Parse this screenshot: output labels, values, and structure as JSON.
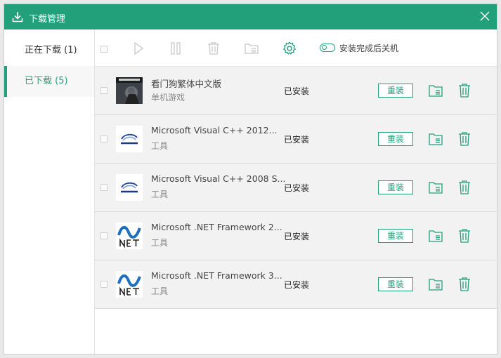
{
  "window": {
    "title": "下载管理"
  },
  "sidebar": {
    "items": [
      {
        "label": "正在下载 (1)"
      },
      {
        "label": "已下载 (5)"
      }
    ]
  },
  "toolbar": {
    "auto_shutdown_label": "安装完成后关机"
  },
  "downloads": [
    {
      "name": "看门狗繁体中文版",
      "category": "单机游戏",
      "status": "已安装",
      "action": "重装"
    },
    {
      "name": "Microsoft Visual C++ 2012...",
      "category": "工具",
      "status": "已安装",
      "action": "重装"
    },
    {
      "name": "Microsoft Visual C++ 2008 S...",
      "category": "工具",
      "status": "已安装",
      "action": "重装"
    },
    {
      "name": "Microsoft .NET Framework 2...",
      "category": "工具",
      "status": "已安装",
      "action": "重装"
    },
    {
      "name": "Microsoft .NET Framework 3...",
      "category": "工具",
      "status": "已安装",
      "action": "重装"
    }
  ],
  "colors": {
    "accent": "#22a07a"
  }
}
